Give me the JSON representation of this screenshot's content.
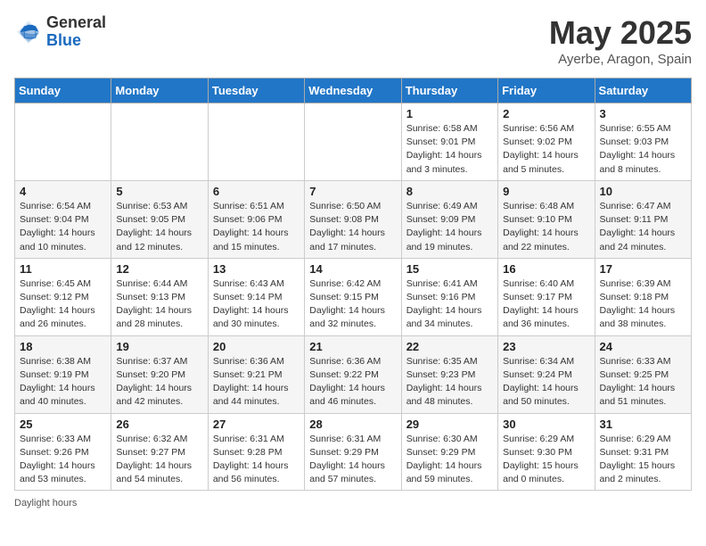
{
  "header": {
    "logo_general": "General",
    "logo_blue": "Blue",
    "title": "May 2025",
    "location": "Ayerbe, Aragon, Spain"
  },
  "days_of_week": [
    "Sunday",
    "Monday",
    "Tuesday",
    "Wednesday",
    "Thursday",
    "Friday",
    "Saturday"
  ],
  "weeks": [
    [
      {
        "day": "",
        "info": ""
      },
      {
        "day": "",
        "info": ""
      },
      {
        "day": "",
        "info": ""
      },
      {
        "day": "",
        "info": ""
      },
      {
        "day": "1",
        "info": "Sunrise: 6:58 AM\nSunset: 9:01 PM\nDaylight: 14 hours\nand 3 minutes."
      },
      {
        "day": "2",
        "info": "Sunrise: 6:56 AM\nSunset: 9:02 PM\nDaylight: 14 hours\nand 5 minutes."
      },
      {
        "day": "3",
        "info": "Sunrise: 6:55 AM\nSunset: 9:03 PM\nDaylight: 14 hours\nand 8 minutes."
      }
    ],
    [
      {
        "day": "4",
        "info": "Sunrise: 6:54 AM\nSunset: 9:04 PM\nDaylight: 14 hours\nand 10 minutes."
      },
      {
        "day": "5",
        "info": "Sunrise: 6:53 AM\nSunset: 9:05 PM\nDaylight: 14 hours\nand 12 minutes."
      },
      {
        "day": "6",
        "info": "Sunrise: 6:51 AM\nSunset: 9:06 PM\nDaylight: 14 hours\nand 15 minutes."
      },
      {
        "day": "7",
        "info": "Sunrise: 6:50 AM\nSunset: 9:08 PM\nDaylight: 14 hours\nand 17 minutes."
      },
      {
        "day": "8",
        "info": "Sunrise: 6:49 AM\nSunset: 9:09 PM\nDaylight: 14 hours\nand 19 minutes."
      },
      {
        "day": "9",
        "info": "Sunrise: 6:48 AM\nSunset: 9:10 PM\nDaylight: 14 hours\nand 22 minutes."
      },
      {
        "day": "10",
        "info": "Sunrise: 6:47 AM\nSunset: 9:11 PM\nDaylight: 14 hours\nand 24 minutes."
      }
    ],
    [
      {
        "day": "11",
        "info": "Sunrise: 6:45 AM\nSunset: 9:12 PM\nDaylight: 14 hours\nand 26 minutes."
      },
      {
        "day": "12",
        "info": "Sunrise: 6:44 AM\nSunset: 9:13 PM\nDaylight: 14 hours\nand 28 minutes."
      },
      {
        "day": "13",
        "info": "Sunrise: 6:43 AM\nSunset: 9:14 PM\nDaylight: 14 hours\nand 30 minutes."
      },
      {
        "day": "14",
        "info": "Sunrise: 6:42 AM\nSunset: 9:15 PM\nDaylight: 14 hours\nand 32 minutes."
      },
      {
        "day": "15",
        "info": "Sunrise: 6:41 AM\nSunset: 9:16 PM\nDaylight: 14 hours\nand 34 minutes."
      },
      {
        "day": "16",
        "info": "Sunrise: 6:40 AM\nSunset: 9:17 PM\nDaylight: 14 hours\nand 36 minutes."
      },
      {
        "day": "17",
        "info": "Sunrise: 6:39 AM\nSunset: 9:18 PM\nDaylight: 14 hours\nand 38 minutes."
      }
    ],
    [
      {
        "day": "18",
        "info": "Sunrise: 6:38 AM\nSunset: 9:19 PM\nDaylight: 14 hours\nand 40 minutes."
      },
      {
        "day": "19",
        "info": "Sunrise: 6:37 AM\nSunset: 9:20 PM\nDaylight: 14 hours\nand 42 minutes."
      },
      {
        "day": "20",
        "info": "Sunrise: 6:36 AM\nSunset: 9:21 PM\nDaylight: 14 hours\nand 44 minutes."
      },
      {
        "day": "21",
        "info": "Sunrise: 6:36 AM\nSunset: 9:22 PM\nDaylight: 14 hours\nand 46 minutes."
      },
      {
        "day": "22",
        "info": "Sunrise: 6:35 AM\nSunset: 9:23 PM\nDaylight: 14 hours\nand 48 minutes."
      },
      {
        "day": "23",
        "info": "Sunrise: 6:34 AM\nSunset: 9:24 PM\nDaylight: 14 hours\nand 50 minutes."
      },
      {
        "day": "24",
        "info": "Sunrise: 6:33 AM\nSunset: 9:25 PM\nDaylight: 14 hours\nand 51 minutes."
      }
    ],
    [
      {
        "day": "25",
        "info": "Sunrise: 6:33 AM\nSunset: 9:26 PM\nDaylight: 14 hours\nand 53 minutes."
      },
      {
        "day": "26",
        "info": "Sunrise: 6:32 AM\nSunset: 9:27 PM\nDaylight: 14 hours\nand 54 minutes."
      },
      {
        "day": "27",
        "info": "Sunrise: 6:31 AM\nSunset: 9:28 PM\nDaylight: 14 hours\nand 56 minutes."
      },
      {
        "day": "28",
        "info": "Sunrise: 6:31 AM\nSunset: 9:29 PM\nDaylight: 14 hours\nand 57 minutes."
      },
      {
        "day": "29",
        "info": "Sunrise: 6:30 AM\nSunset: 9:29 PM\nDaylight: 14 hours\nand 59 minutes."
      },
      {
        "day": "30",
        "info": "Sunrise: 6:29 AM\nSunset: 9:30 PM\nDaylight: 15 hours\nand 0 minutes."
      },
      {
        "day": "31",
        "info": "Sunrise: 6:29 AM\nSunset: 9:31 PM\nDaylight: 15 hours\nand 2 minutes."
      }
    ]
  ],
  "footer": {
    "label": "Daylight hours"
  }
}
